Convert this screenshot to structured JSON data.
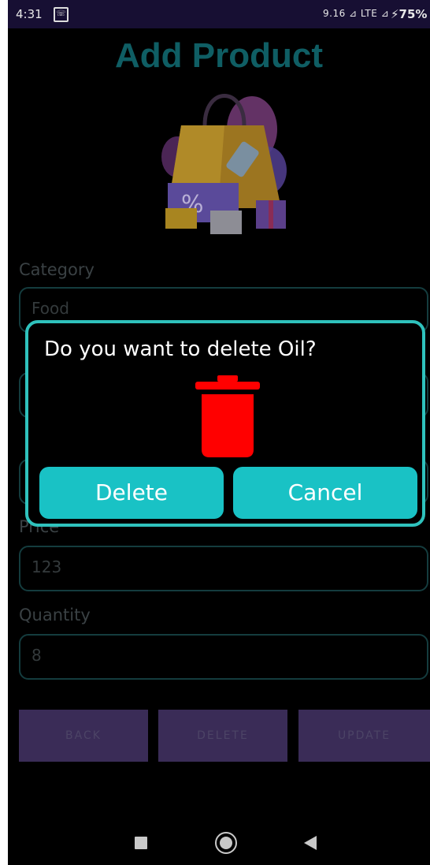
{
  "status_bar": {
    "time": "4:31",
    "app_icon": "phone-app-icon",
    "signal_text": "9.16 ⊿ LTE ⊿",
    "battery": "⚡75%"
  },
  "page": {
    "title": "Add Product",
    "illustration": "shopping-bag-illustration"
  },
  "form": {
    "category_label": "Category",
    "category_value": "Food",
    "price_label": "Price",
    "price_value": "123",
    "quantity_label": "Quantity",
    "quantity_value": "8"
  },
  "actions": {
    "back": "BACK",
    "delete": "DELETE",
    "update": "UPDATE"
  },
  "dialog": {
    "message": "Do you want to delete Oil?",
    "icon": "trash-icon",
    "delete_label": "Delete",
    "cancel_label": "Cancel"
  },
  "colors": {
    "accent": "#19c2c5",
    "dialog_border": "#2fc2bd",
    "trash": "#ff0000",
    "title": "#0f5e64",
    "button_bg": "#3a2c57"
  },
  "nav_bar": [
    "recents-square-icon",
    "home-circle-icon",
    "back-triangle-icon"
  ]
}
